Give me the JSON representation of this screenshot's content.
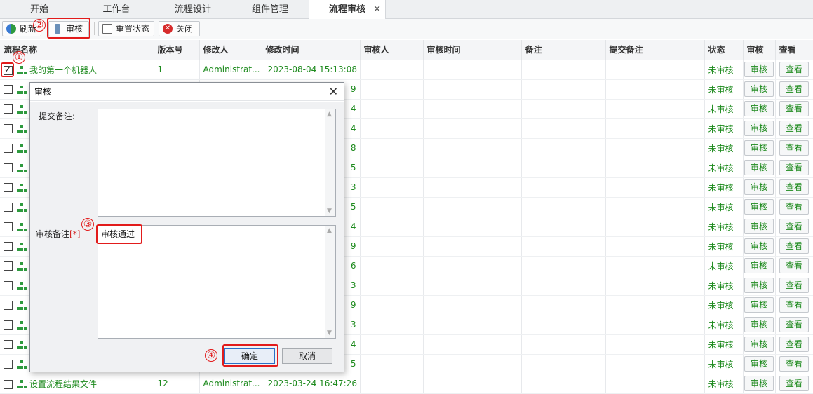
{
  "tabs": [
    "开始",
    "工作台",
    "流程设计",
    "组件管理",
    "流程审核"
  ],
  "tab_close": "✕",
  "toolbar": {
    "refresh": "刷新",
    "audit": "审核",
    "reset": "重置状态",
    "close": "关闭"
  },
  "columns": [
    "流程名称",
    "版本号",
    "修改人",
    "修改时间",
    "审核人",
    "审核时间",
    "备注",
    "提交备注",
    "状态",
    "审核",
    "查看"
  ],
  "rows": [
    {
      "name": "我的第一个机器人",
      "version": "1",
      "modifier": "Administrat...",
      "time": "2023-08-04 15:13:08",
      "checked": true
    },
    {
      "name": "",
      "version": "",
      "modifier": "",
      "time": "9"
    },
    {
      "name": "",
      "version": "",
      "modifier": "",
      "time": "4"
    },
    {
      "name": "",
      "version": "",
      "modifier": "",
      "time": "4"
    },
    {
      "name": "",
      "version": "",
      "modifier": "",
      "time": "8"
    },
    {
      "name": "",
      "version": "",
      "modifier": "",
      "time": "5"
    },
    {
      "name": "",
      "version": "",
      "modifier": "",
      "time": "3"
    },
    {
      "name": "",
      "version": "",
      "modifier": "",
      "time": "5"
    },
    {
      "name": "",
      "version": "",
      "modifier": "",
      "time": "4"
    },
    {
      "name": "",
      "version": "",
      "modifier": "",
      "time": "9"
    },
    {
      "name": "",
      "version": "",
      "modifier": "",
      "time": "6"
    },
    {
      "name": "",
      "version": "",
      "modifier": "",
      "time": "3"
    },
    {
      "name": "",
      "version": "",
      "modifier": "",
      "time": "9"
    },
    {
      "name": "",
      "version": "",
      "modifier": "",
      "time": "3"
    },
    {
      "name": "",
      "version": "",
      "modifier": "",
      "time": "4"
    },
    {
      "name": "",
      "version": "",
      "modifier": "",
      "time": "5"
    },
    {
      "name": "设置流程结果文件",
      "version": "12",
      "modifier": "Administrat...",
      "time": "2023-03-24 16:47:26"
    }
  ],
  "status_text": "未审核",
  "audit_btn": "审核",
  "view_btn": "查看",
  "dialog": {
    "title": "审核",
    "close": "✕",
    "submit_note_label": "提交备注:",
    "audit_note_label": "审核备注",
    "required": "[*]",
    "audit_note_value": "审核通过",
    "ok": "确定",
    "cancel": "取消"
  },
  "markers": [
    "①",
    "②",
    "③",
    "④"
  ],
  "colors": {
    "accent_green": "#1d8a1d",
    "annotation_red": "#e21b1b"
  }
}
